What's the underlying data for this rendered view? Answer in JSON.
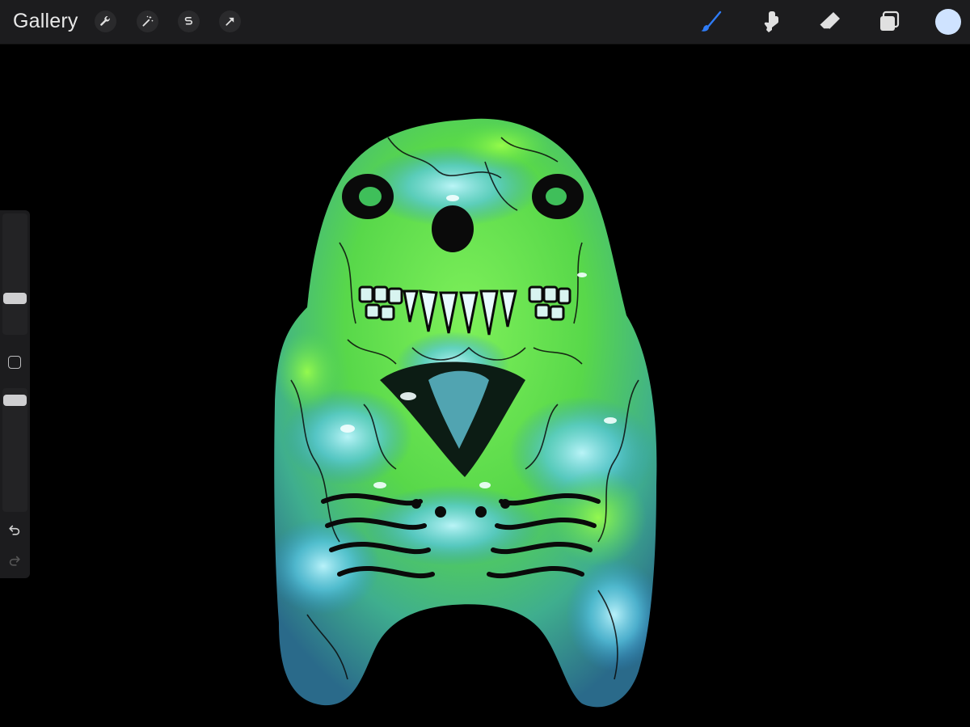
{
  "app": {
    "gallery_label": "Gallery"
  },
  "toolbar_left": [
    {
      "name": "actions-wrench-icon"
    },
    {
      "name": "adjustments-magic-wand-icon"
    },
    {
      "name": "selection-icon"
    },
    {
      "name": "transform-arrow-icon"
    }
  ],
  "toolbar_right": [
    {
      "name": "brush-icon",
      "active": true
    },
    {
      "name": "smudge-icon",
      "active": false
    },
    {
      "name": "eraser-icon",
      "active": false
    },
    {
      "name": "layers-icon",
      "active": false
    }
  ],
  "colors": {
    "accent": "#2f7cf6",
    "current_color": "#cfe3ff",
    "icon": "#e0e0e0",
    "toolbar_bg": "#1c1c1e"
  },
  "sidebar": {
    "brush_size_level": 0.28,
    "opacity_level": 0.06
  },
  "canvas": {
    "description_icon": "artwork-3d-model"
  }
}
